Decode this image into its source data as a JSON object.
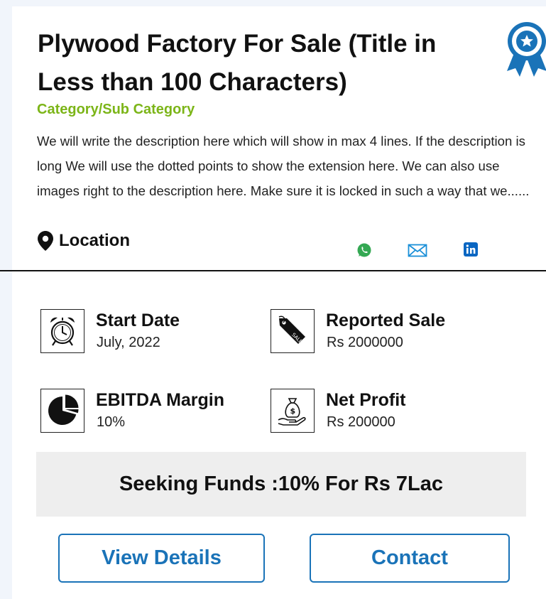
{
  "listing": {
    "title": "Plywood Factory For Sale (Title in Less than 100 Characters)",
    "category": "Category/Sub Category",
    "description": "We will write the description here which will show in max 4 lines. If the description is long We will use the dotted points to show the extension here. We can also use images right to the description here. Make sure it is locked in such a way that we......",
    "location": "Location"
  },
  "icons": {
    "badge": "award-ribbon-icon",
    "location": "map-pin-icon",
    "whatsapp": "whatsapp-icon",
    "email": "email-icon",
    "linkedin": "linkedin-icon",
    "start_date": "alarm-clock-icon",
    "reported_sale": "sale-tag-icon",
    "ebitda": "pie-chart-icon",
    "net_profit": "money-bag-hand-icon"
  },
  "stats": {
    "start_date": {
      "label": "Start Date",
      "value": "July, 2022"
    },
    "reported_sale": {
      "label": "Reported Sale",
      "value": "Rs 2000000"
    },
    "ebitda": {
      "label": "EBITDA Margin",
      "value": "10%"
    },
    "net_profit": {
      "label": "Net Profit",
      "value": "Rs 200000"
    }
  },
  "seeking": "Seeking Funds :10% For Rs 7Lac",
  "actions": {
    "view_details": "View Details",
    "contact": "Contact"
  },
  "colors": {
    "accent": "#1a73b8",
    "category": "#7cb518",
    "whatsapp": "#34a853",
    "email": "#1a8fd8",
    "linkedin": "#0a66c2"
  }
}
